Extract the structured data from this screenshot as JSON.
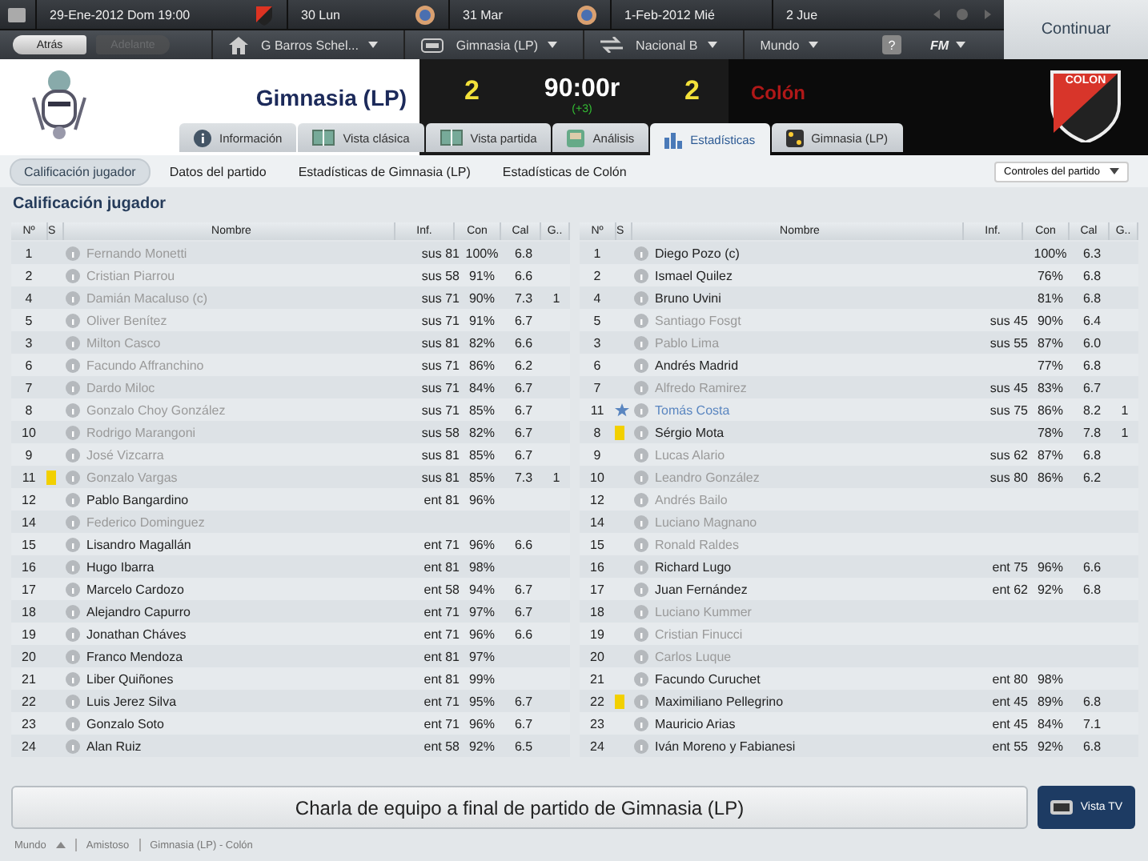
{
  "top_bar": {
    "days": [
      {
        "label": "29-Ene-2012 Dom 19:00",
        "kind": "home"
      },
      {
        "label": "30 Lun",
        "kind": "away"
      },
      {
        "label": "31 Mar",
        "kind": "away"
      },
      {
        "label": "1-Feb-2012 Mié",
        "kind": "plain"
      },
      {
        "label": "2 Jue",
        "kind": "plain"
      }
    ],
    "continue_button": "Continuar"
  },
  "nav_bar": {
    "back": {
      "label": "Atrás",
      "disabled": false
    },
    "forward": {
      "label": "Adelante",
      "disabled": true
    },
    "menus": [
      "G Barros Schel...",
      "Gimnasia (LP)",
      "Nacional B",
      "Mundo"
    ],
    "help": "?",
    "fm": "FM"
  },
  "header": {
    "home_team": "Gimnasia (LP)",
    "home_score": "2",
    "clock": "90:00r",
    "added_time": "(+3)",
    "away_score": "2",
    "away_team": "Colón",
    "away_crest_label": "COLON"
  },
  "tabs": [
    {
      "label": "Información",
      "selected": false
    },
    {
      "label": "Vista clásica",
      "selected": false
    },
    {
      "label": "Vista partida",
      "selected": false
    },
    {
      "label": "Análisis",
      "selected": false
    },
    {
      "label": "Estadísticas",
      "selected": true
    },
    {
      "label": "Gimnasia (LP)",
      "selected": false
    }
  ],
  "subtabs": [
    {
      "label": "Calificación jugador",
      "selected": true
    },
    {
      "label": "Datos del partido",
      "selected": false
    },
    {
      "label": "Estadísticas de Gimnasia (LP)",
      "selected": false
    },
    {
      "label": "Estadísticas de Colón",
      "selected": false
    }
  ],
  "match_controls": "Controles del partido",
  "section_title": "Calificación jugador",
  "tables": [
    {
      "columns": [
        "Nº",
        "S",
        "Nombre",
        "Inf.",
        "Con",
        "Cal",
        "G.."
      ],
      "rows": [
        {
          "no": "1",
          "booked": false,
          "best": false,
          "dimmed": true,
          "name": "Fernando Monetti",
          "inf": "sus 81",
          "con": "100%",
          "cal": "6.8"
        },
        {
          "no": "2",
          "booked": false,
          "best": false,
          "dimmed": true,
          "name": "Cristian Piarrou",
          "inf": "sus 58",
          "con": "91%",
          "cal": "6.6"
        },
        {
          "no": "4",
          "booked": false,
          "best": false,
          "dimmed": true,
          "name": "Damián Macaluso (c)",
          "inf": "sus 71",
          "con": "90%",
          "cal": "7.3",
          "g": "1"
        },
        {
          "no": "5",
          "booked": false,
          "best": false,
          "dimmed": true,
          "name": "Oliver Benítez",
          "inf": "sus 71",
          "con": "91%",
          "cal": "6.7"
        },
        {
          "no": "3",
          "booked": false,
          "best": false,
          "dimmed": true,
          "name": "Milton Casco",
          "inf": "sus 81",
          "con": "82%",
          "cal": "6.6"
        },
        {
          "no": "6",
          "booked": false,
          "best": false,
          "dimmed": true,
          "name": "Facundo Affranchino",
          "inf": "sus 71",
          "con": "86%",
          "cal": "6.2"
        },
        {
          "no": "7",
          "booked": false,
          "best": false,
          "dimmed": true,
          "name": "Dardo Miloc",
          "inf": "sus 71",
          "con": "84%",
          "cal": "6.7"
        },
        {
          "no": "8",
          "booked": false,
          "best": false,
          "dimmed": true,
          "name": "Gonzalo Choy González",
          "inf": "sus 71",
          "con": "85%",
          "cal": "6.7"
        },
        {
          "no": "10",
          "booked": false,
          "best": false,
          "dimmed": true,
          "name": "Rodrigo Marangoni",
          "inf": "sus 58",
          "con": "82%",
          "cal": "6.7"
        },
        {
          "no": "9",
          "booked": false,
          "best": false,
          "dimmed": true,
          "name": "José Vizcarra",
          "inf": "sus 81",
          "con": "85%",
          "cal": "6.7"
        },
        {
          "no": "11",
          "booked": true,
          "best": false,
          "dimmed": true,
          "name": "Gonzalo Vargas",
          "inf": "sus 81",
          "con": "85%",
          "cal": "7.3",
          "g": "1"
        },
        {
          "no": "12",
          "booked": false,
          "best": false,
          "dimmed": false,
          "name": "Pablo Bangardino",
          "inf": "ent 81",
          "con": "96%"
        },
        {
          "no": "14",
          "booked": false,
          "best": false,
          "dimmed": true,
          "name": "Federico Dominguez"
        },
        {
          "no": "15",
          "booked": false,
          "best": false,
          "dimmed": false,
          "name": "Lisandro Magallán",
          "inf": "ent 71",
          "con": "96%",
          "cal": "6.6"
        },
        {
          "no": "16",
          "booked": false,
          "best": false,
          "dimmed": false,
          "name": "Hugo Ibarra",
          "inf": "ent 81",
          "con": "98%"
        },
        {
          "no": "17",
          "booked": false,
          "best": false,
          "dimmed": false,
          "name": "Marcelo Cardozo",
          "inf": "ent 58",
          "con": "94%",
          "cal": "6.7"
        },
        {
          "no": "18",
          "booked": false,
          "best": false,
          "dimmed": false,
          "name": "Alejandro Capurro",
          "inf": "ent 71",
          "con": "97%",
          "cal": "6.7"
        },
        {
          "no": "19",
          "booked": false,
          "best": false,
          "dimmed": false,
          "name": "Jonathan Cháves",
          "inf": "ent 71",
          "con": "96%",
          "cal": "6.6"
        },
        {
          "no": "20",
          "booked": false,
          "best": false,
          "dimmed": false,
          "name": "Franco Mendoza",
          "inf": "ent 81",
          "con": "97%"
        },
        {
          "no": "21",
          "booked": false,
          "best": false,
          "dimmed": false,
          "name": "Liber Quiñones",
          "inf": "ent 81",
          "con": "99%"
        },
        {
          "no": "22",
          "booked": false,
          "best": false,
          "dimmed": false,
          "name": "Luis Jerez Silva",
          "inf": "ent 71",
          "con": "95%",
          "cal": "6.7"
        },
        {
          "no": "23",
          "booked": false,
          "best": false,
          "dimmed": false,
          "name": "Gonzalo Soto",
          "inf": "ent 71",
          "con": "96%",
          "cal": "6.7"
        },
        {
          "no": "24",
          "booked": false,
          "best": false,
          "dimmed": false,
          "name": "Alan Ruiz",
          "inf": "ent 58",
          "con": "92%",
          "cal": "6.5"
        }
      ]
    },
    {
      "columns": [
        "Nº",
        "S",
        "Nombre",
        "Inf.",
        "Con",
        "Cal",
        "G.."
      ],
      "rows": [
        {
          "no": "1",
          "booked": false,
          "best": false,
          "dimmed": false,
          "name": "Diego Pozo (c)",
          "con": "100%",
          "cal": "6.3"
        },
        {
          "no": "2",
          "booked": false,
          "best": false,
          "dimmed": false,
          "name": "Ismael Quilez",
          "con": "76%",
          "cal": "6.8"
        },
        {
          "no": "4",
          "booked": false,
          "best": false,
          "dimmed": false,
          "name": "Bruno Uvini",
          "con": "81%",
          "cal": "6.8"
        },
        {
          "no": "5",
          "booked": false,
          "best": false,
          "dimmed": true,
          "name": "Santiago Fosgt",
          "inf": "sus 45",
          "con": "90%",
          "cal": "6.4"
        },
        {
          "no": "3",
          "booked": false,
          "best": false,
          "dimmed": true,
          "name": "Pablo Lima",
          "inf": "sus 55",
          "con": "87%",
          "cal": "6.0"
        },
        {
          "no": "6",
          "booked": false,
          "best": false,
          "dimmed": false,
          "name": "Andrés Madrid",
          "con": "77%",
          "cal": "6.8"
        },
        {
          "no": "7",
          "booked": false,
          "best": false,
          "dimmed": true,
          "name": "Alfredo Ramirez",
          "inf": "sus 45",
          "con": "83%",
          "cal": "6.7"
        },
        {
          "no": "11",
          "booked": false,
          "best": true,
          "dimmed": false,
          "name": "Tomás Costa",
          "inf": "sus 75",
          "con": "86%",
          "cal": "8.2",
          "g": "1"
        },
        {
          "no": "8",
          "booked": true,
          "best": false,
          "dimmed": false,
          "name": "Sérgio Mota",
          "con": "78%",
          "cal": "7.8",
          "g": "1"
        },
        {
          "no": "9",
          "booked": false,
          "best": false,
          "dimmed": true,
          "name": "Lucas Alario",
          "inf": "sus 62",
          "con": "87%",
          "cal": "6.8"
        },
        {
          "no": "10",
          "booked": false,
          "best": false,
          "dimmed": true,
          "name": "Leandro González",
          "inf": "sus 80",
          "con": "86%",
          "cal": "6.2"
        },
        {
          "no": "12",
          "booked": false,
          "best": false,
          "dimmed": true,
          "name": "Andrés Bailo"
        },
        {
          "no": "14",
          "booked": false,
          "best": false,
          "dimmed": true,
          "name": "Luciano Magnano"
        },
        {
          "no": "15",
          "booked": false,
          "best": false,
          "dimmed": true,
          "name": "Ronald Raldes"
        },
        {
          "no": "16",
          "booked": false,
          "best": false,
          "dimmed": false,
          "name": "Richard Lugo",
          "inf": "ent 75",
          "con": "96%",
          "cal": "6.6"
        },
        {
          "no": "17",
          "booked": false,
          "best": false,
          "dimmed": false,
          "name": "Juan Fernández",
          "inf": "ent 62",
          "con": "92%",
          "cal": "6.8"
        },
        {
          "no": "18",
          "booked": false,
          "best": false,
          "dimmed": true,
          "name": "Luciano Kummer"
        },
        {
          "no": "19",
          "booked": false,
          "best": false,
          "dimmed": true,
          "name": "Cristian Finucci"
        },
        {
          "no": "20",
          "booked": false,
          "best": false,
          "dimmed": true,
          "name": "Carlos Luque"
        },
        {
          "no": "21",
          "booked": false,
          "best": false,
          "dimmed": false,
          "name": "Facundo Curuchet",
          "inf": "ent 80",
          "con": "98%"
        },
        {
          "no": "22",
          "booked": true,
          "best": false,
          "dimmed": false,
          "name": "Maximiliano Pellegrino",
          "inf": "ent 45",
          "con": "89%",
          "cal": "6.8"
        },
        {
          "no": "23",
          "booked": false,
          "best": false,
          "dimmed": false,
          "name": "Mauricio Arias",
          "inf": "ent 45",
          "con": "84%",
          "cal": "7.1"
        },
        {
          "no": "24",
          "booked": false,
          "best": false,
          "dimmed": false,
          "name": "Iván Moreno y Fabianesi",
          "inf": "ent 55",
          "con": "92%",
          "cal": "6.8"
        }
      ]
    }
  ],
  "team_talk_button": "Charla de equipo a final de partido de Gimnasia (LP)",
  "tv_button": "Vista TV",
  "status_bar": [
    "Mundo",
    "Amistoso",
    "Gimnasia (LP) - Colón"
  ]
}
